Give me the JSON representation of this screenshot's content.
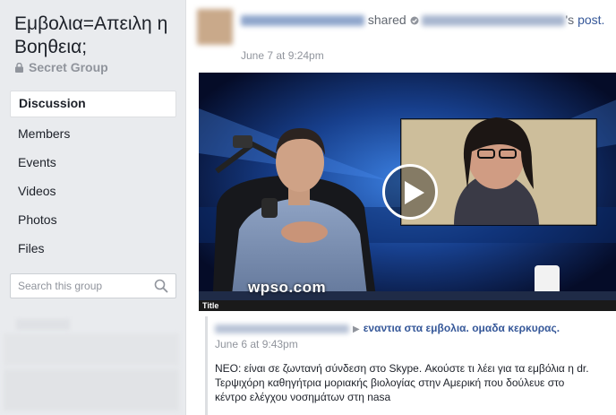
{
  "sidebar": {
    "group_name": "Εμβολια=Απειλη η Βοηθεια;",
    "privacy": "Secret Group",
    "nav": [
      {
        "label": "Discussion",
        "active": true
      },
      {
        "label": "Members"
      },
      {
        "label": "Events"
      },
      {
        "label": "Videos"
      },
      {
        "label": "Photos"
      },
      {
        "label": "Files"
      }
    ],
    "search_placeholder": "Search this group"
  },
  "post": {
    "shared_word": "shared",
    "possessive_suffix": "'s",
    "post_word": "post.",
    "timestamp": "June 7 at 9:24pm",
    "video": {
      "watermark": "wpso.com",
      "title_bar": "Title"
    },
    "original": {
      "target_group": "εναντια στα εμβολια. ομαδα κερκυρας.",
      "timestamp": "June 6 at 9:43pm",
      "text": "ΝΕΟ: είναι σε ζωντανή σύνδεση στο Skype. Ακούστε τι λέει για τα εμβόλια η dr. Τερψιχόρη καθηγήτρια μοριακής βιολογίας στην Αμερική που δούλευε στο κέντρο ελέγχου νοσημάτων στη nasa"
    }
  },
  "colors": {
    "background": "#e9ebee",
    "link": "#365899",
    "muted": "#90949c"
  }
}
